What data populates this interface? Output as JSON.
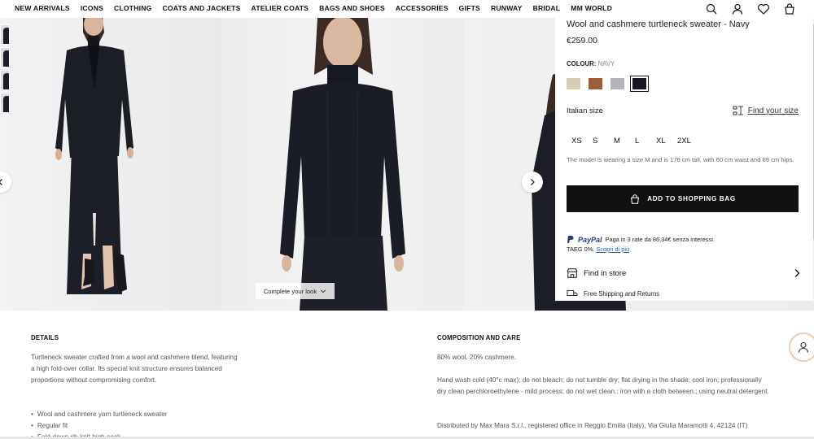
{
  "nav": {
    "links": [
      "NEW ARRIVALS",
      "ICONS",
      "CLOTHING",
      "COATS AND JACKETS",
      "ATELIER COATS",
      "BAGS AND SHOES",
      "ACCESSORIES",
      "GIFTS",
      "RUNWAY",
      "BRIDAL",
      "MM WORLD"
    ]
  },
  "gallery": {
    "complete_look_label": "Complete your look"
  },
  "product": {
    "title": "Wool and cashmere turtleneck sweater - Navy",
    "price": "€259.00",
    "colour_label": "COLOUR:",
    "colour_value": "NAVY",
    "swatches": [
      "#d9ccb6",
      "#9c5f37",
      "#b5b4b9",
      "#141822"
    ],
    "selected_swatch": 3,
    "size_label": "Italian size",
    "find_size_label": "Find your size",
    "sizes": [
      "XS",
      "S",
      "M",
      "L",
      "XL",
      "2XL"
    ],
    "model_info": "The model is wearing a size M and is 178 cm tall, with 60 cm waist and 89 cm hips.",
    "add_to_bag_label": "ADD TO SHOPPING BAG",
    "paypal_logo_text": "PayPal",
    "paypal_text": "Paga in 3 rate da 86,34€ senza interessi.",
    "taeg_text": "TAEG 0%.",
    "taeg_link": "Scopri di più",
    "find_in_store": "Find in store",
    "free_shipping": "Free Shipping and Returns"
  },
  "details": {
    "title": "DETAILS",
    "text": "Turtleneck sweater crafted from a wool and cashmere blend, featuring a high fold-over collar. Its special knit structure ensures balanced proportions without compromising comfort.",
    "bullets": [
      "Wool and cashmere yarn turtleneck sweater",
      "Regular fit",
      "Fold-down rib-knit high neck"
    ]
  },
  "composition": {
    "title": "COMPOSITION AND CARE",
    "material": "80% wool, 20% cashmere.",
    "care": "Hand wash cold (40°c max); do not bleach; do not tumble dry; flat drying in the shade; cool iron; professionally dry clean perchloroethylene - mild process; do not wet clean.; iron with a cloth between.; using neutral detergent.",
    "distributor": "Distributed by Max Mara S.r.l., registered office in Reggio Emilia (Italy), Via Giulia Maramotti 4, 42124 (IT)"
  }
}
